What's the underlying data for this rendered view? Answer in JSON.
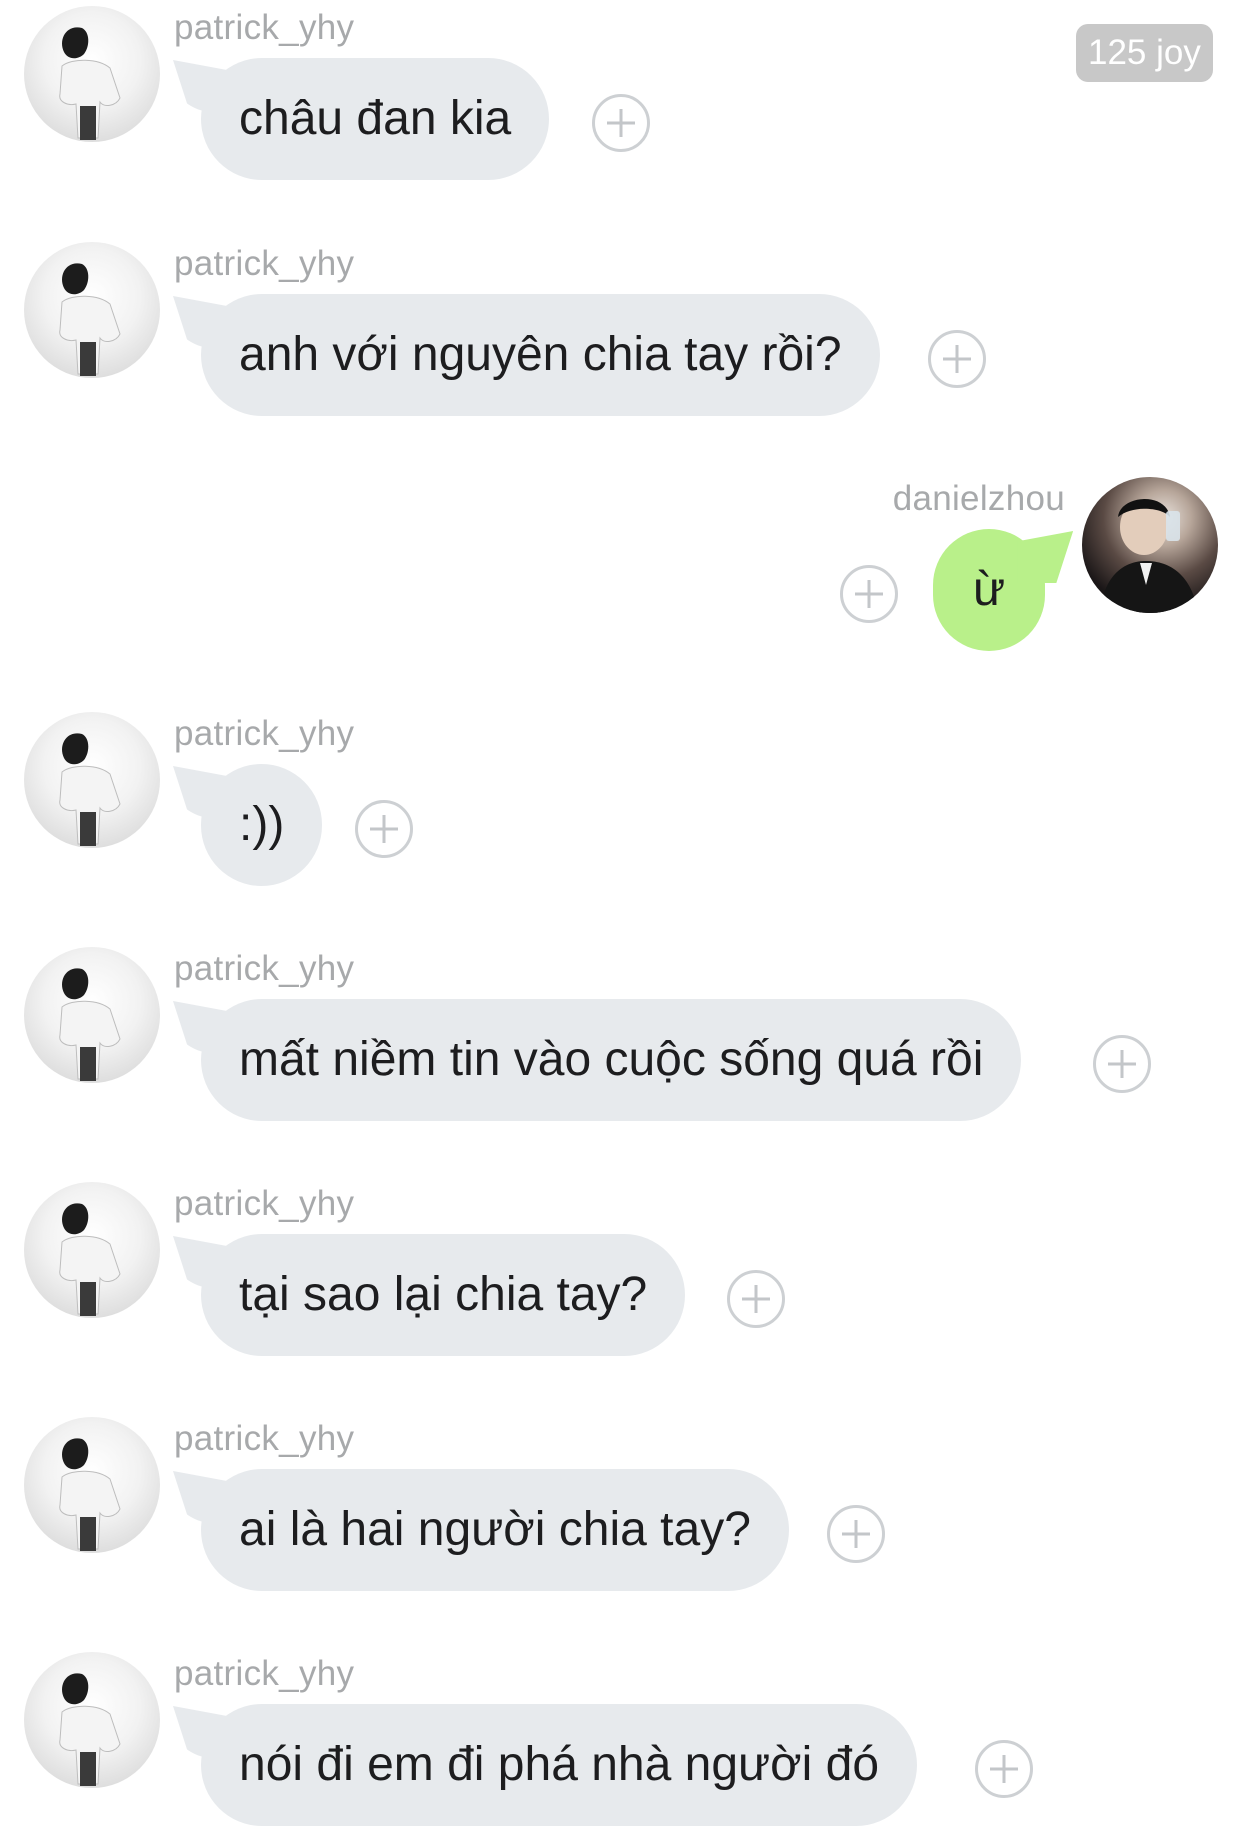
{
  "header": {
    "joy_badge": "125 joy"
  },
  "messages": [
    {
      "sender": "patrick_yhy",
      "text": "châu đan kia"
    },
    {
      "sender": "patrick_yhy",
      "text": "anh với nguyên chia tay rồi?"
    },
    {
      "sender": "danielzhou",
      "text": "ừ"
    },
    {
      "sender": "patrick_yhy",
      "text": ":))"
    },
    {
      "sender": "patrick_yhy",
      "text": "mất niềm tin vào cuộc sống quá rồi"
    },
    {
      "sender": "patrick_yhy",
      "text": "tại sao lại chia tay?"
    },
    {
      "sender": "patrick_yhy",
      "text": "ai là hai người chia tay?"
    },
    {
      "sender": "patrick_yhy",
      "text": "nói đi em đi phá nhà người đó"
    }
  ],
  "colors": {
    "incoming_bubble": "#e7eaed",
    "outgoing_bubble": "#b9f08a",
    "username": "#a7a9ab",
    "badge_bg": "#c8c8c8"
  },
  "icons": {
    "add_reaction": "plus-circle-icon",
    "avatar_incoming": "avatar-patrick",
    "avatar_outgoing": "avatar-daniel"
  }
}
